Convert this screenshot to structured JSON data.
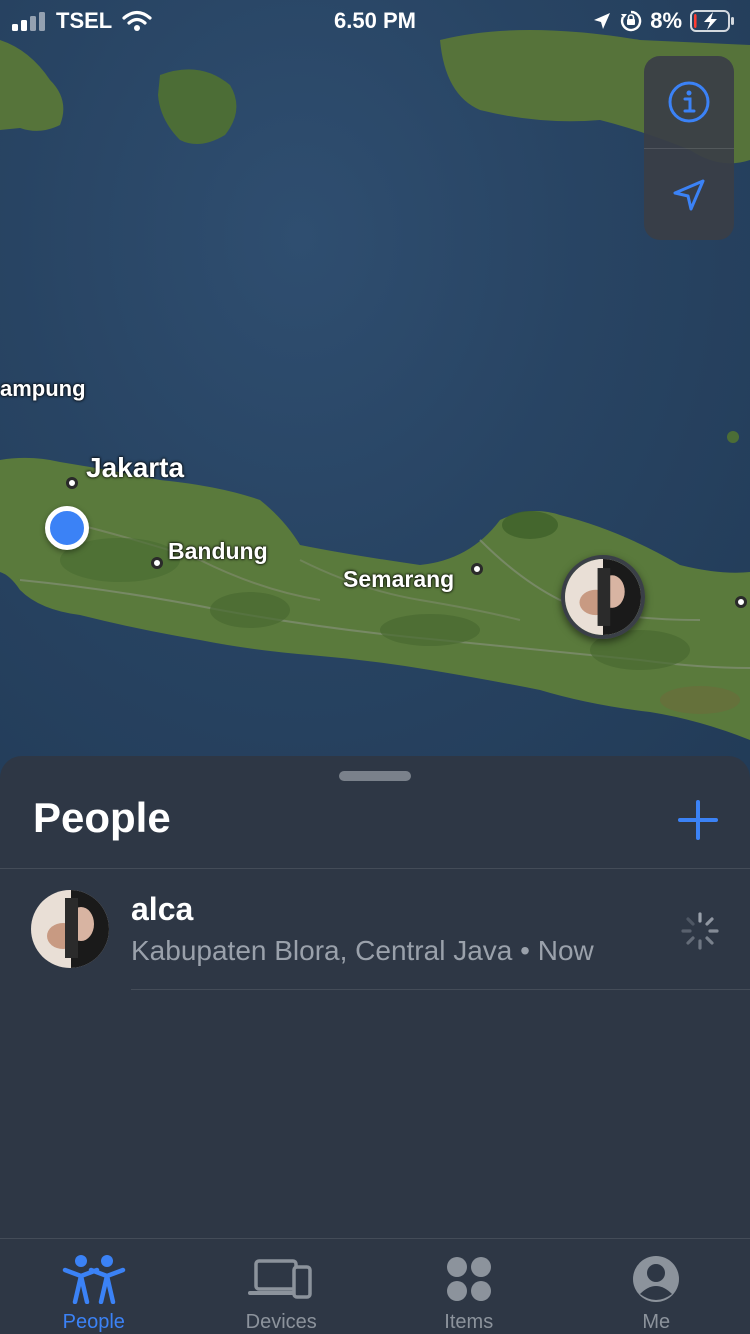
{
  "status_bar": {
    "carrier": "TSEL",
    "time": "6.50 PM",
    "battery": "8%",
    "battery_level": 0.08
  },
  "map": {
    "cities": [
      {
        "name": "ampung"
      },
      {
        "name": "Jakarta"
      },
      {
        "name": "Bandung"
      },
      {
        "name": "Semarang"
      }
    ],
    "controls": {
      "info_icon": "info-icon",
      "location_icon": "location-arrow-icon"
    }
  },
  "sheet": {
    "title": "People",
    "add_icon": "plus-icon",
    "people": [
      {
        "name": "alca",
        "location": "Kabupaten Blora, Central Java",
        "time": "Now"
      }
    ]
  },
  "tab_bar": {
    "tabs": [
      {
        "label": "People",
        "icon": "people-icon",
        "active": true
      },
      {
        "label": "Devices",
        "icon": "devices-icon",
        "active": false
      },
      {
        "label": "Items",
        "icon": "items-icon",
        "active": false
      },
      {
        "label": "Me",
        "icon": "me-icon",
        "active": false
      }
    ]
  },
  "colors": {
    "accent": "#3b82f6",
    "sheet_bg": "#2e3745",
    "secondary_text": "#9aa1ab"
  }
}
